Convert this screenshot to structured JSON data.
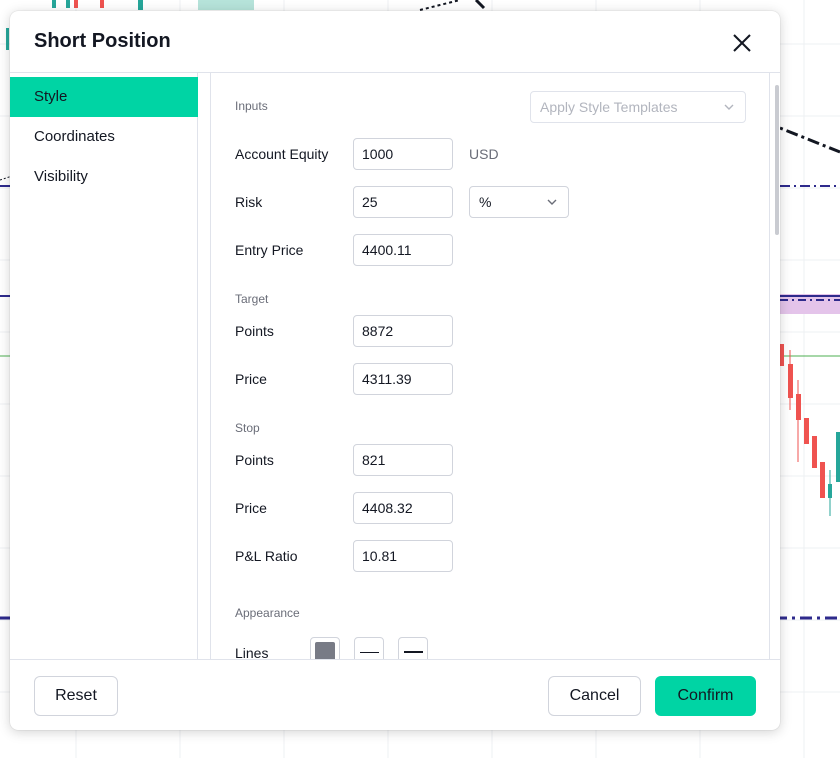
{
  "colors": {
    "accent": "#00d4a4",
    "border": "#e0e3eb",
    "muted_text": "#6a6d78",
    "placeholder_text": "#b2b5be",
    "swatch": "#787b86",
    "candle_up": "#26a69a",
    "candle_down": "#ef5350",
    "chart_line": "#2e2a8c"
  },
  "dialog": {
    "title": "Short Position",
    "close_icon": "close-icon"
  },
  "sidebar": {
    "items": [
      {
        "label": "Style",
        "active": true
      },
      {
        "label": "Coordinates",
        "active": false
      },
      {
        "label": "Visibility",
        "active": false
      }
    ]
  },
  "inputs": {
    "section_label": "Inputs",
    "templates_placeholder": "Apply Style Templates",
    "account_equity": {
      "label": "Account Equity",
      "value": "1000",
      "unit": "USD"
    },
    "risk": {
      "label": "Risk",
      "value": "25",
      "unit_selected": "%"
    },
    "entry_price": {
      "label": "Entry Price",
      "value": "4400.11"
    }
  },
  "target": {
    "section_label": "Target",
    "points": {
      "label": "Points",
      "value": "8872"
    },
    "price": {
      "label": "Price",
      "value": "4311.39"
    }
  },
  "stop": {
    "section_label": "Stop",
    "points": {
      "label": "Points",
      "value": "821"
    },
    "price": {
      "label": "Price",
      "value": "4408.32"
    },
    "pl_ratio": {
      "label": "P&L Ratio",
      "value": "10.81"
    }
  },
  "appearance": {
    "section_label": "Appearance",
    "lines_label": "Lines"
  },
  "footer": {
    "reset_label": "Reset",
    "cancel_label": "Cancel",
    "confirm_label": "Confirm"
  }
}
